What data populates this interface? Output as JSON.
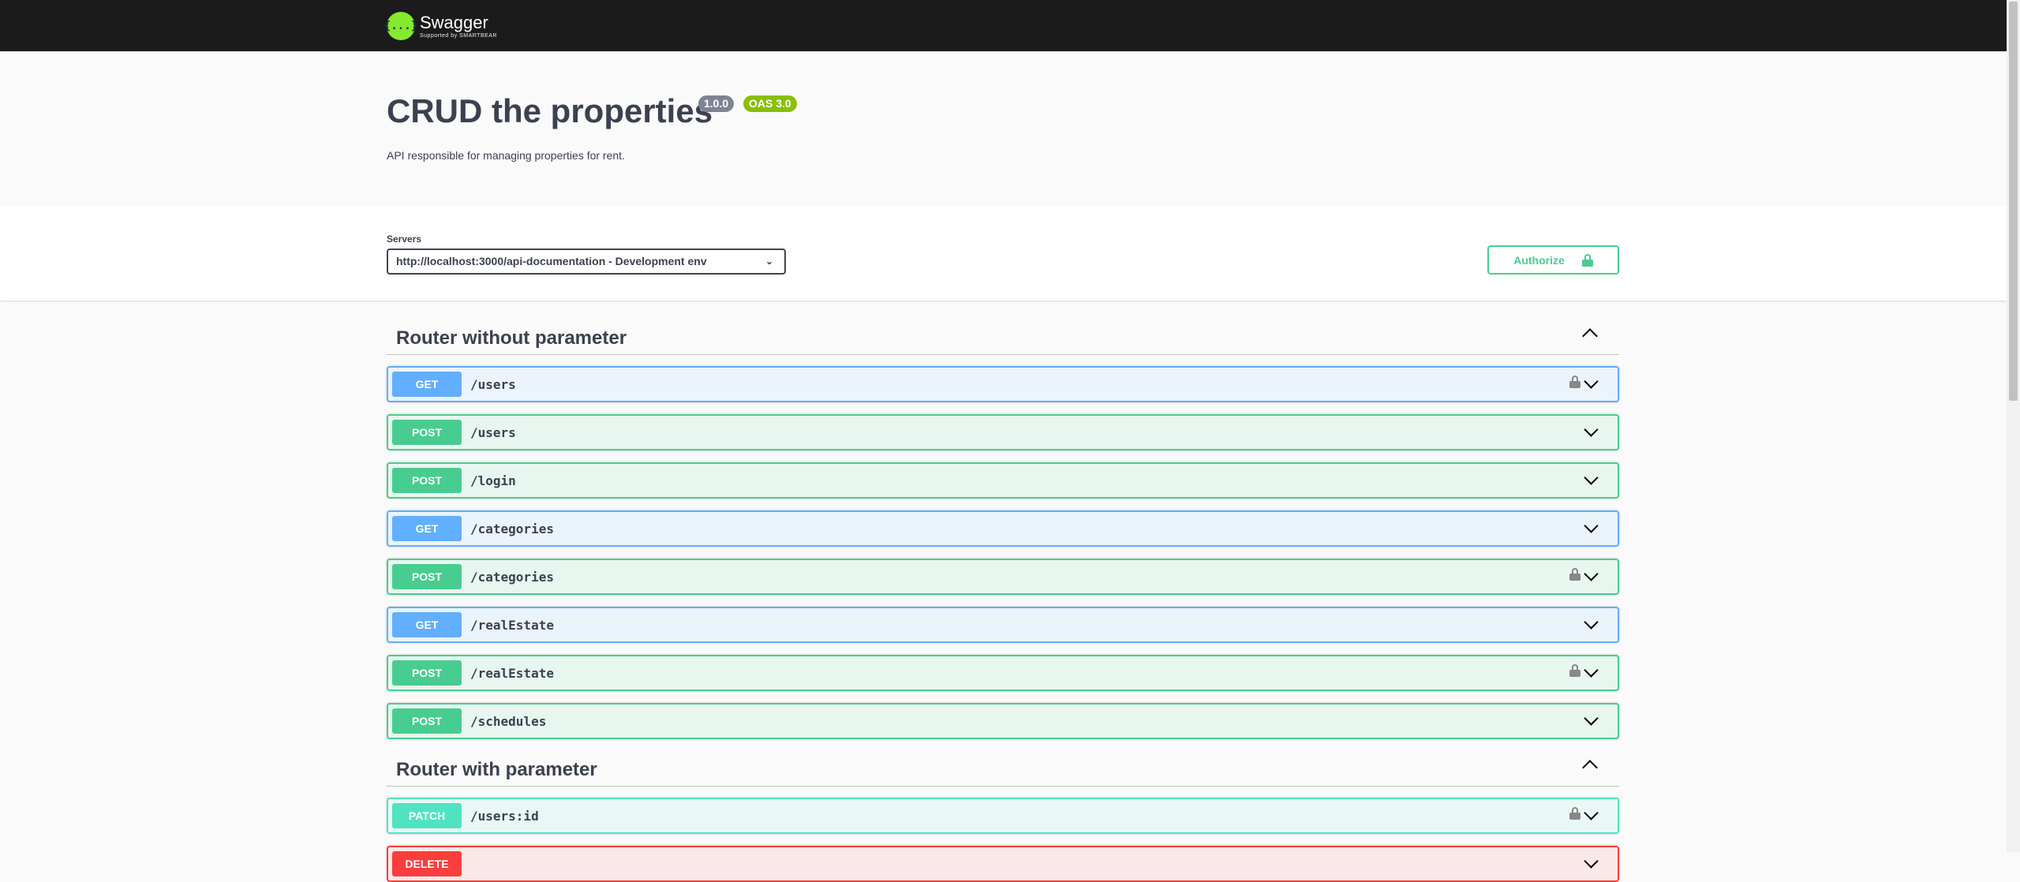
{
  "brand": {
    "name": "Swagger",
    "tagline": "Supported by SMARTBEAR",
    "logo_glyph": "{...}"
  },
  "info": {
    "title": "CRUD the properties",
    "version": "1.0.0",
    "oas": "OAS 3.0",
    "description": "API responsible for managing properties for rent."
  },
  "servers": {
    "label": "Servers",
    "selected": "http://localhost:3000/api-documentation - Development env"
  },
  "authorize": {
    "label": "Authorize",
    "icon": "lock-icon"
  },
  "sections": [
    {
      "title": "Router without parameter",
      "operations": [
        {
          "method": "GET",
          "path": "/users",
          "locked": true
        },
        {
          "method": "POST",
          "path": "/users",
          "locked": false
        },
        {
          "method": "POST",
          "path": "/login",
          "locked": false
        },
        {
          "method": "GET",
          "path": "/categories",
          "locked": false
        },
        {
          "method": "POST",
          "path": "/categories",
          "locked": true
        },
        {
          "method": "GET",
          "path": "/realEstate",
          "locked": false
        },
        {
          "method": "POST",
          "path": "/realEstate",
          "locked": true
        },
        {
          "method": "POST",
          "path": "/schedules",
          "locked": false
        }
      ]
    },
    {
      "title": "Router with parameter",
      "operations": [
        {
          "method": "PATCH",
          "path": "/users:id",
          "locked": true
        },
        {
          "method": "DELETE",
          "path": "",
          "locked": false
        }
      ]
    }
  ],
  "colors": {
    "get": "#61affe",
    "post": "#49cc90",
    "patch": "#50e3c2",
    "delete": "#f93e3e",
    "topbar": "#1b1b1b",
    "swagger_green": "#85ea2d"
  }
}
